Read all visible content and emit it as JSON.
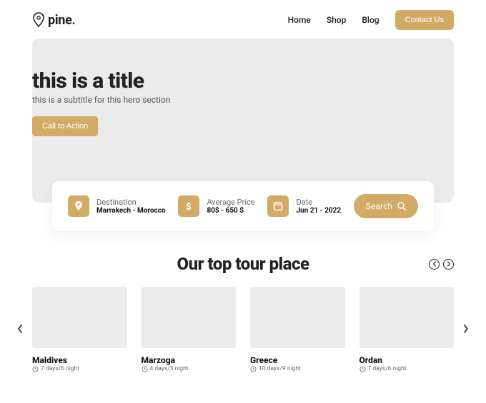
{
  "brand": {
    "name": "pine."
  },
  "nav": {
    "links": [
      "Home",
      "Shop",
      "Blog"
    ],
    "contact": "Contact Us"
  },
  "hero": {
    "title": "this is a title",
    "subtitle": "this is a subtitle for this hero section",
    "cta": "Call to Action"
  },
  "search": {
    "fields": [
      {
        "label": "Destination",
        "value": "Marrakech - Morocco"
      },
      {
        "label": "Average Price",
        "value": "80$ - 650 $"
      },
      {
        "label": "Date",
        "value": "Jun 21 - 2022"
      }
    ],
    "button": "Search"
  },
  "tours": {
    "heading": "Our top tour place",
    "cards": [
      {
        "title": "Maldives",
        "meta": "7 days/6 night"
      },
      {
        "title": "Marzoga",
        "meta": "4 days/3 night"
      },
      {
        "title": "Greece",
        "meta": "10 days/9 night"
      },
      {
        "title": "Ordan",
        "meta": "7 days/6 night"
      }
    ]
  }
}
